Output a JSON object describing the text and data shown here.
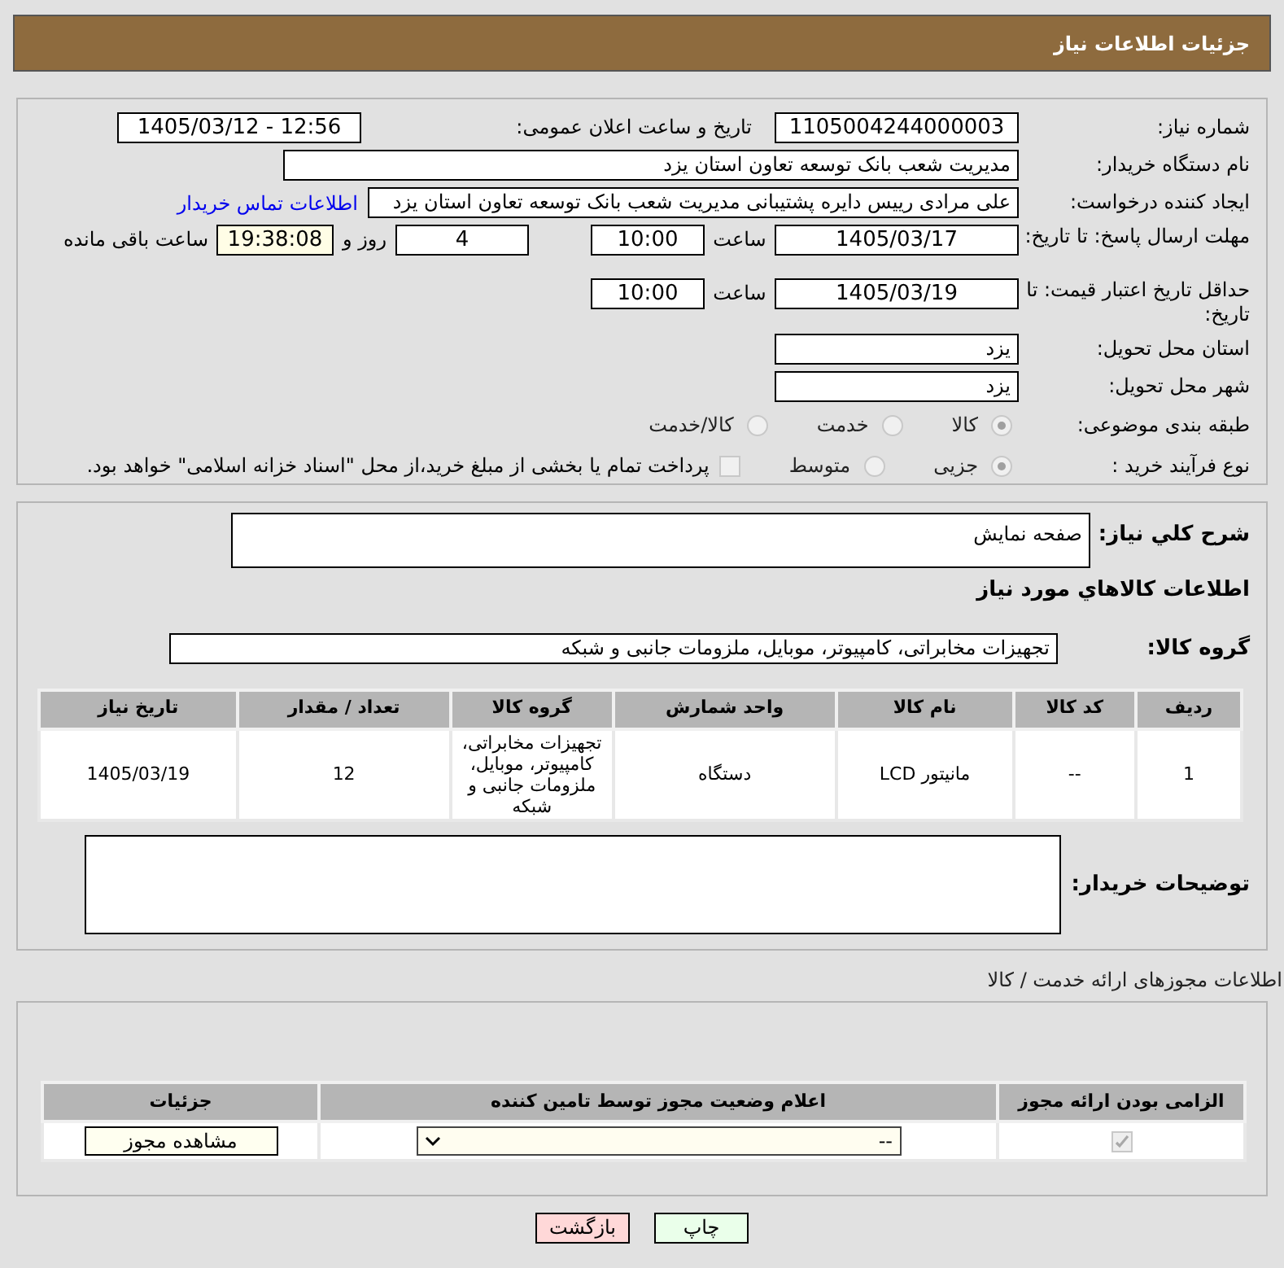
{
  "header": {
    "title": "جزئیات اطلاعات نیاز"
  },
  "need_number": {
    "label": "شماره نیاز:",
    "value": "1105004244000003"
  },
  "announce": {
    "label": "تاریخ و ساعت اعلان عمومی:",
    "value": "1405/03/12 - 12:56"
  },
  "buyer_org": {
    "label": "نام دستگاه خریدار:",
    "value": "مدیریت شعب بانک توسعه تعاون استان یزد"
  },
  "requester": {
    "label": "ایجاد کننده درخواست:",
    "value": "علی مرادی رییس دایره پشتیبانی مدیریت شعب بانک توسعه تعاون استان یزد",
    "link": "اطلاعات تماس خریدار"
  },
  "reply_deadline": {
    "label": "مهلت ارسال پاسخ: تا تاریخ:",
    "date": "1405/03/17",
    "time_label": "ساعت",
    "time": "10:00",
    "days": "4",
    "days_label": "روز و",
    "remaining": "19:38:08",
    "remaining_label": "ساعت باقی مانده"
  },
  "price_validity": {
    "label": "حداقل تاریخ اعتبار قیمت: تا تاریخ:",
    "date": "1405/03/19",
    "time_label": "ساعت",
    "time": "10:00"
  },
  "province": {
    "label": "استان محل تحویل:",
    "value": "یزد"
  },
  "city": {
    "label": "شهر محل تحویل:",
    "value": "یزد"
  },
  "category": {
    "label": "طبقه بندی موضوعی:",
    "options": [
      {
        "label": "کالا",
        "selected": true
      },
      {
        "label": "خدمت",
        "selected": false
      },
      {
        "label": "کالا/خدمت",
        "selected": false
      }
    ]
  },
  "purchase_process": {
    "label": "نوع فرآیند خرید :",
    "options": [
      {
        "label": "جزیی",
        "selected": true
      },
      {
        "label": "متوسط",
        "selected": false
      }
    ],
    "payment": {
      "label": "پرداخت تمام یا بخشی از مبلغ خرید،از محل \"اسناد خزانه اسلامی\" خواهد بود.",
      "checked": false
    }
  },
  "description": {
    "label": "شرح کلي نياز:",
    "value": "صفحه نمایش"
  },
  "goods_title": "اطلاعات کالاهاي مورد نياز",
  "goods_group": {
    "label": "گروه کالا:",
    "value": "تجهیزات مخابراتی، کامپیوتر، موبایل، ملزومات جانبی و شبکه"
  },
  "goods_table": {
    "columns": [
      "ردیف",
      "کد کالا",
      "نام کالا",
      "واحد شمارش",
      "گروه کالا",
      "تعداد / مقدار",
      "تاریخ نیاز"
    ],
    "rows": [
      [
        "1",
        "--",
        "مانیتور LCD",
        "دستگاه",
        "تجهیزات مخابراتی، کامپیوتر، موبایل، ملزومات جانبی و شبکه",
        "12",
        "1405/03/19"
      ]
    ]
  },
  "buyer_notes": {
    "label": "توضیحات خریدار:"
  },
  "permits": {
    "title": "اطلاعات مجوزهای ارائه خدمت / کالا",
    "columns": [
      "الزامی بودن ارائه مجوز",
      "اعلام وضعیت مجوز توسط تامین کننده",
      "جزئیات"
    ],
    "rows": [
      {
        "required": true,
        "status": "--",
        "button": "مشاهده مجوز"
      }
    ]
  },
  "buttons": [
    {
      "label": "چاپ",
      "kind": "print"
    },
    {
      "label": "بازگشت",
      "kind": "back"
    }
  ]
}
